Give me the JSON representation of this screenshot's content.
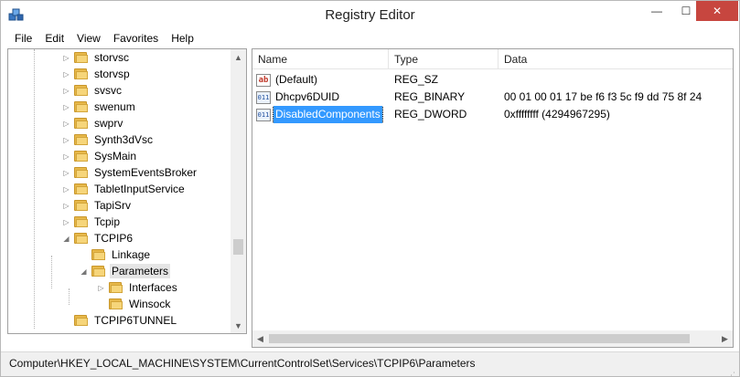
{
  "window": {
    "title": "Registry Editor",
    "app_icon": "registry-editor-icon",
    "controls": {
      "minimize": "—",
      "maximize": "☐",
      "close": "✕"
    }
  },
  "menu": [
    "File",
    "Edit",
    "View",
    "Favorites",
    "Help"
  ],
  "tree": {
    "items": [
      {
        "label": "storvsc",
        "expander": "collapsed"
      },
      {
        "label": "storvsp",
        "expander": "collapsed"
      },
      {
        "label": "svsvc",
        "expander": "collapsed"
      },
      {
        "label": "swenum",
        "expander": "collapsed"
      },
      {
        "label": "swprv",
        "expander": "collapsed"
      },
      {
        "label": "Synth3dVsc",
        "expander": "collapsed"
      },
      {
        "label": "SysMain",
        "expander": "collapsed"
      },
      {
        "label": "SystemEventsBroker",
        "expander": "collapsed"
      },
      {
        "label": "TabletInputService",
        "expander": "collapsed"
      },
      {
        "label": "TapiSrv",
        "expander": "collapsed"
      },
      {
        "label": "Tcpip",
        "expander": "collapsed"
      },
      {
        "label": "TCPIP6",
        "expander": "expanded"
      },
      {
        "label": "Linkage",
        "expander": "none"
      },
      {
        "label": "Parameters",
        "expander": "expanded",
        "selected": true
      },
      {
        "label": "Interfaces",
        "expander": "collapsed"
      },
      {
        "label": "Winsock",
        "expander": "none"
      },
      {
        "label": "TCPIP6TUNNEL",
        "expander": "none"
      }
    ]
  },
  "list": {
    "columns": [
      "Name",
      "Type",
      "Data"
    ],
    "rows": [
      {
        "icon": "string-value-icon",
        "icon_text": "ab",
        "name": "(Default)",
        "type": "REG_SZ",
        "data": ""
      },
      {
        "icon": "binary-value-icon",
        "icon_text": "011",
        "name": "Dhcpv6DUID",
        "type": "REG_BINARY",
        "data": "00 01 00 01 17 be f6 f3 5c f9 dd 75 8f 24"
      },
      {
        "icon": "binary-value-icon",
        "icon_text": "011",
        "name": "DisabledComponents",
        "type": "REG_DWORD",
        "data": "0xffffffff (4294967295)",
        "selected": true
      }
    ]
  },
  "status": {
    "path": "Computer\\HKEY_LOCAL_MACHINE\\SYSTEM\\CurrentControlSet\\Services\\TCPIP6\\Parameters"
  },
  "colors": {
    "selection": "#3399ff",
    "close_button": "#c7463f",
    "folder": "#f6d57a"
  }
}
